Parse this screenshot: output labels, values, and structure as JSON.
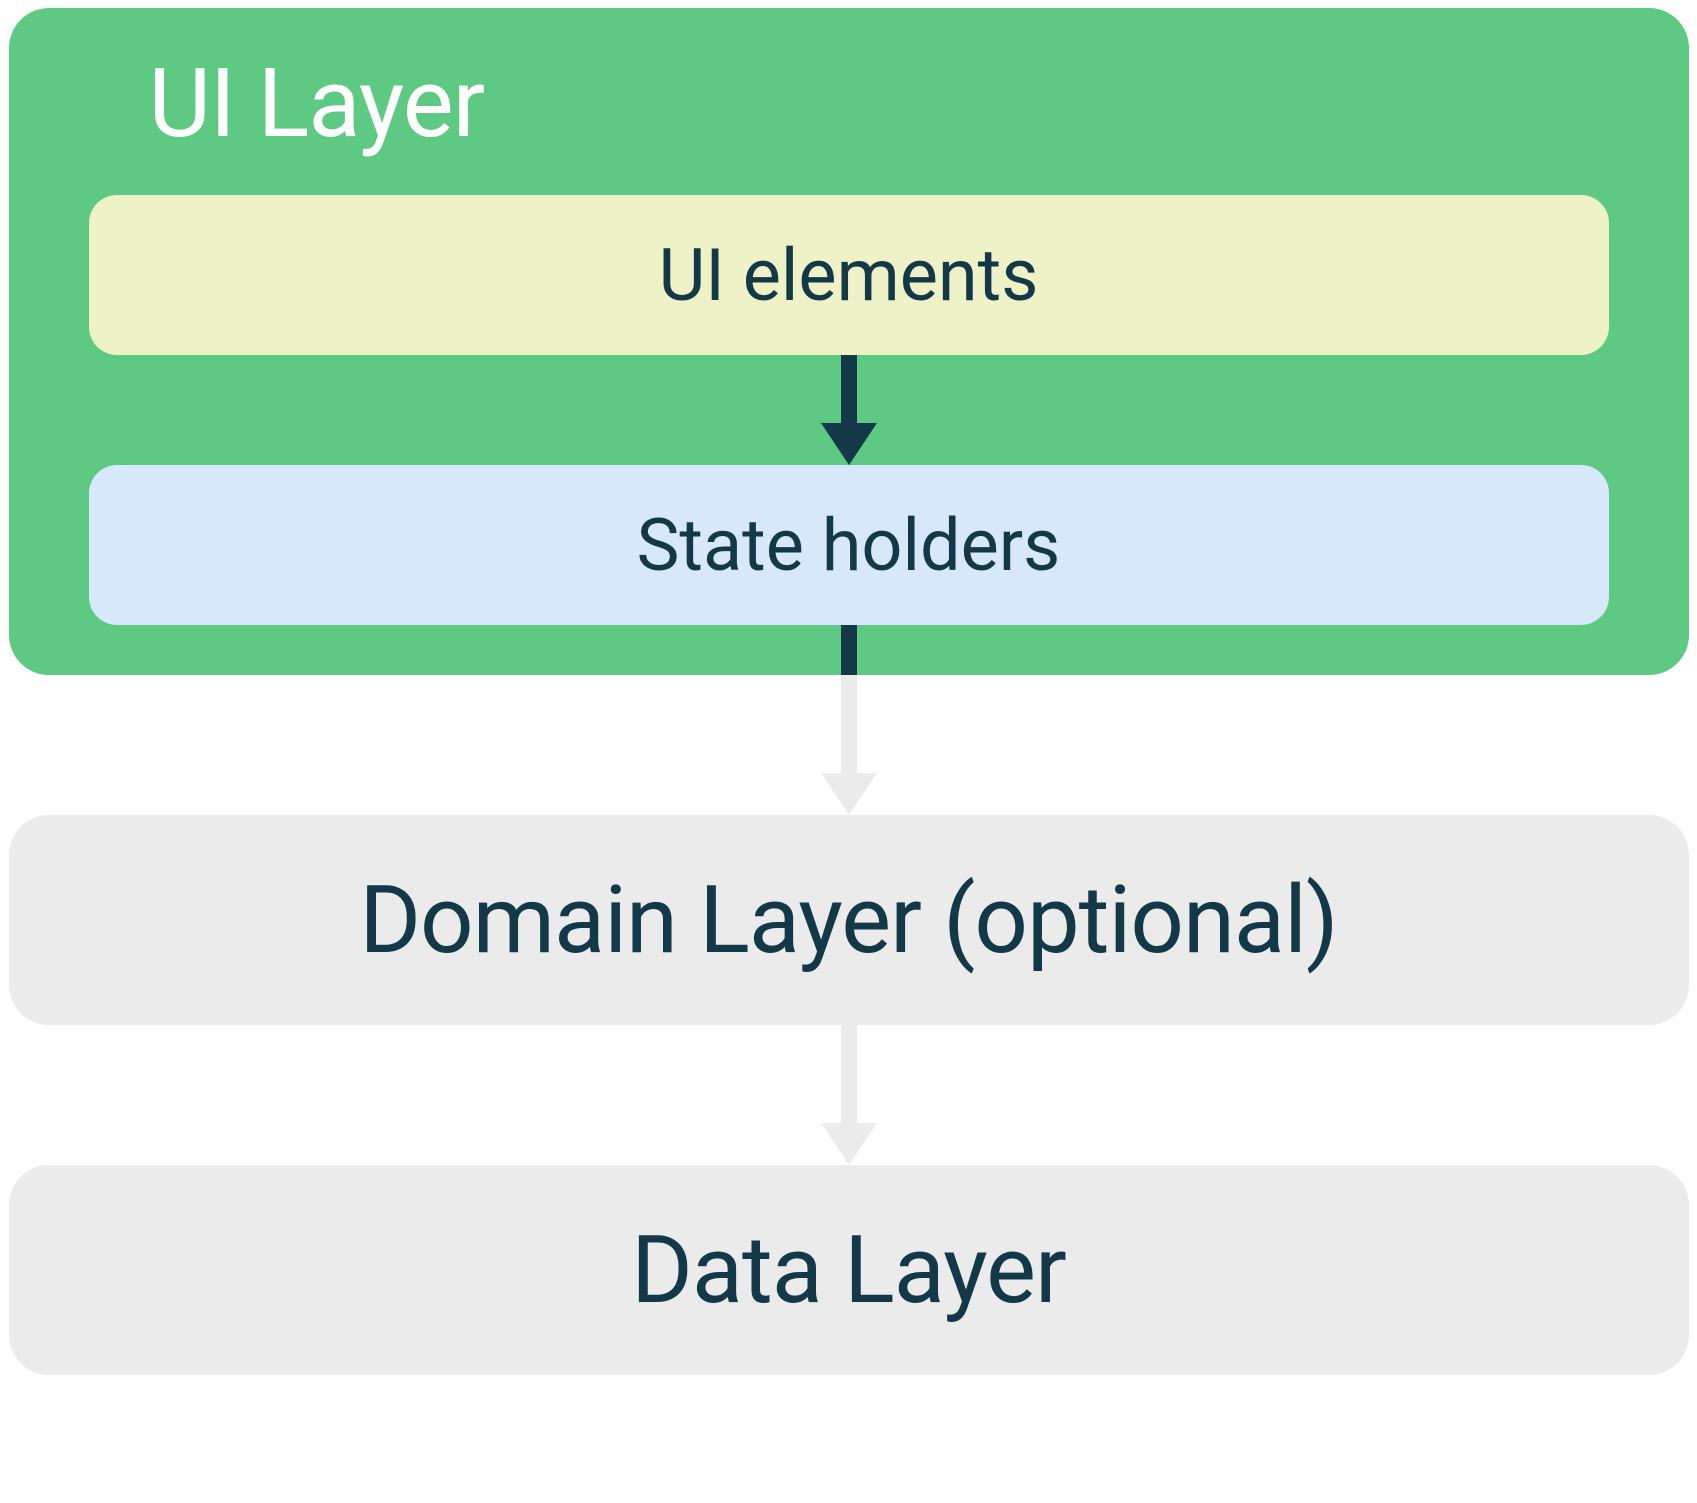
{
  "uiLayer": {
    "title": "UI Layer",
    "uiElements": "UI elements",
    "stateHolders": "State holders"
  },
  "domainLayer": {
    "label": "Domain Layer (optional)"
  },
  "dataLayer": {
    "label": "Data Layer"
  },
  "colors": {
    "uiLayerBg": "#5dc983",
    "uiElementsBg": "#eef2c6",
    "stateHoldersBg": "#d6e8f9",
    "layerBoxBg": "#ebebeb",
    "textDark": "#133847",
    "textLight": "#ffffff",
    "arrowDark": "#133847",
    "arrowLight": "#ebebeb"
  }
}
